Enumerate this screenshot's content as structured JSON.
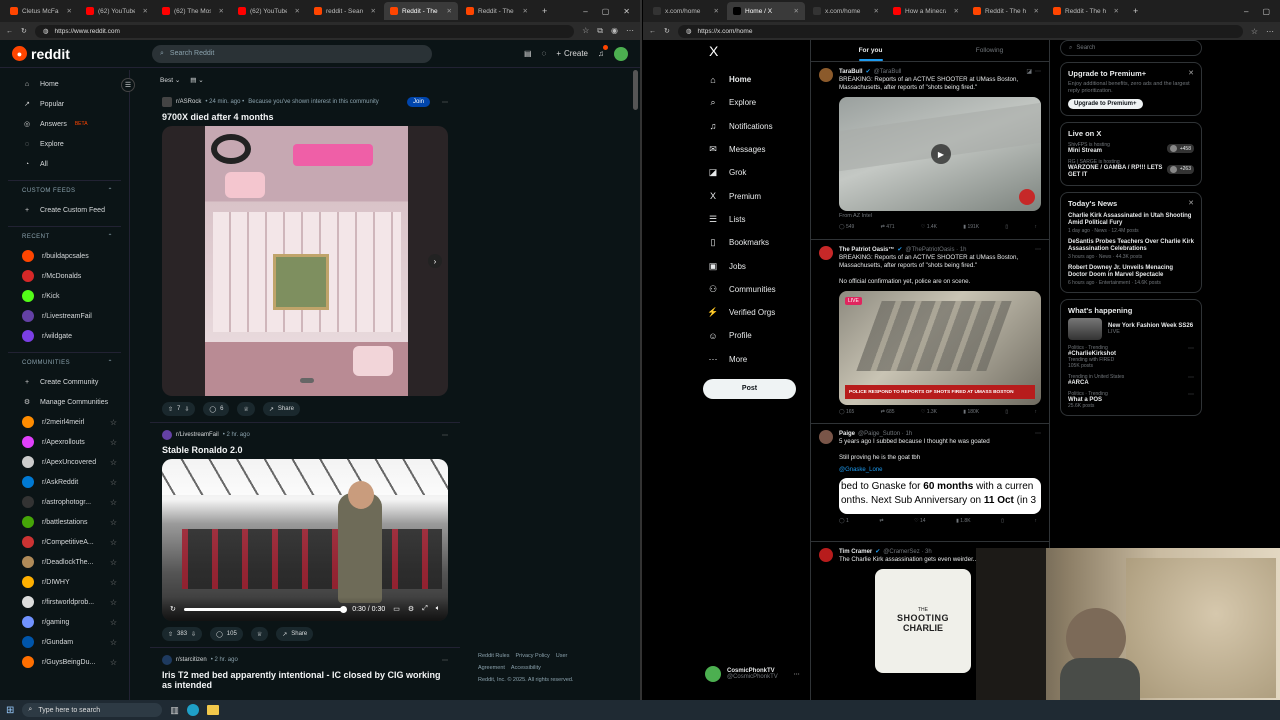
{
  "left_browser": {
    "tabs": [
      {
        "title": "Cletus McFarland",
        "color": "#ff4500"
      },
      {
        "title": "(62) YouTube",
        "color": "#ff0000"
      },
      {
        "title": "(62) The Most Secre",
        "color": "#ff0000"
      },
      {
        "title": "(62) YouTube",
        "color": "#ff0000"
      },
      {
        "title": "reddit - Search",
        "color": "#ff4500"
      },
      {
        "title": "Reddit - The heart o",
        "color": "#ff4500",
        "active": true
      },
      {
        "title": "Reddit - The heart o",
        "color": "#ff4500"
      }
    ],
    "url": "https://www.reddit.com"
  },
  "reddit": {
    "brand": "reddit",
    "search_placeholder": "Search Reddit",
    "create_label": "Create",
    "nav": [
      {
        "label": "Home",
        "icon": "home-icon",
        "glyph": "⌂"
      },
      {
        "label": "Popular",
        "icon": "popular-icon",
        "glyph": "↗"
      },
      {
        "label": "Answers",
        "icon": "answers-icon",
        "glyph": "◎",
        "badge": "BETA"
      },
      {
        "label": "Explore",
        "icon": "explore-icon",
        "glyph": "◌"
      },
      {
        "label": "All",
        "icon": "all-icon",
        "glyph": "◔"
      }
    ],
    "custom_feeds_title": "CUSTOM FEEDS",
    "create_custom_feed": "Create Custom Feed",
    "recent_title": "RECENT",
    "recent": [
      {
        "name": "r/buildapcsales",
        "color": "#ff4500"
      },
      {
        "name": "r/McDonalds",
        "color": "#d62828"
      },
      {
        "name": "r/Kick",
        "color": "#53fc18"
      },
      {
        "name": "r/LivestreamFail",
        "color": "#6441a5"
      },
      {
        "name": "r/wildgate",
        "color": "#7b3fe4"
      }
    ],
    "communities_title": "COMMUNITIES",
    "create_community": "Create Community",
    "manage_communities": "Manage Communities",
    "communities": [
      {
        "name": "r/2meirl4meirl",
        "color": "#ff8c00"
      },
      {
        "name": "r/Apexrollouts",
        "color": "#e040fb"
      },
      {
        "name": "r/ApexUncovered",
        "color": "#cccccc"
      },
      {
        "name": "r/AskReddit",
        "color": "#0079d3"
      },
      {
        "name": "r/astrophotogr...",
        "color": "#333333"
      },
      {
        "name": "r/battlestations",
        "color": "#46a508"
      },
      {
        "name": "r/CompetitiveA...",
        "color": "#cc3333"
      },
      {
        "name": "r/DeadlockThe...",
        "color": "#b08b59"
      },
      {
        "name": "r/DIWHY",
        "color": "#ffb000"
      },
      {
        "name": "r/firstworldprob...",
        "color": "#dddddd"
      },
      {
        "name": "r/gaming",
        "color": "#7193ff"
      },
      {
        "name": "r/Gundam",
        "color": "#0055aa"
      },
      {
        "name": "r/GuysBeingDu...",
        "color": "#ff6f00"
      }
    ],
    "sort_label": "Best",
    "posts": [
      {
        "sub": "r/ASRock",
        "time": "24 min. ago",
        "reason": "Because you've shown interest in this community",
        "join": "Join",
        "title": "9700X died after 4 months",
        "votes": "7",
        "comments": "6",
        "share": "Share"
      },
      {
        "sub": "r/LivestreamFail",
        "time": "2 hr. ago",
        "title": "Stable Ronaldo 2.0",
        "video_time": "0:30 / 0:30",
        "votes": "383",
        "comments": "105",
        "share": "Share"
      },
      {
        "sub": "r/starcitizen",
        "time": "2 hr. ago",
        "title": "Iris T2 med bed apparently intentional - IC closed by CIG working as intended"
      }
    ],
    "footer": {
      "links": [
        "Reddit Rules",
        "Privacy Policy",
        "User Agreement",
        "Accessibility"
      ],
      "copyright": "Reddit, Inc. © 2025. All rights reserved."
    }
  },
  "right_browser": {
    "tabs": [
      {
        "title": "x.com/home",
        "color": "#333333"
      },
      {
        "title": "Home / X",
        "color": "#000000",
        "active": true
      },
      {
        "title": "x.com/home",
        "color": "#333333"
      },
      {
        "title": "How a Minecraft Sc",
        "color": "#ff0000"
      },
      {
        "title": "Reddit - The heart",
        "color": "#ff4500"
      },
      {
        "title": "Reddit - The heart",
        "color": "#ff4500"
      }
    ],
    "url": "https://x.com/home"
  },
  "x": {
    "logo": "X",
    "nav": [
      {
        "label": "Home",
        "glyph": "⌂",
        "icon": "home-icon",
        "active": true
      },
      {
        "label": "Explore",
        "glyph": "⌕",
        "icon": "explore-icon"
      },
      {
        "label": "Notifications",
        "glyph": "♫",
        "icon": "bell-icon"
      },
      {
        "label": "Messages",
        "glyph": "✉",
        "icon": "mail-icon"
      },
      {
        "label": "Grok",
        "glyph": "◪",
        "icon": "grok-icon"
      },
      {
        "label": "Premium",
        "glyph": "X",
        "icon": "premium-icon"
      },
      {
        "label": "Lists",
        "glyph": "☰",
        "icon": "lists-icon"
      },
      {
        "label": "Bookmarks",
        "glyph": "▯",
        "icon": "bookmark-icon"
      },
      {
        "label": "Jobs",
        "glyph": "▣",
        "icon": "jobs-icon"
      },
      {
        "label": "Communities",
        "glyph": "⚇",
        "icon": "communities-icon"
      },
      {
        "label": "Verified Orgs",
        "glyph": "⚡",
        "icon": "verified-orgs-icon"
      },
      {
        "label": "Profile",
        "glyph": "☺",
        "icon": "profile-icon"
      },
      {
        "label": "More",
        "glyph": "⋯",
        "icon": "more-icon"
      }
    ],
    "post_button": "Post",
    "account": {
      "name": "CosmicPhonkTV",
      "handle": "@CosmicPhonkTV"
    },
    "feed_tabs": [
      "For you",
      "Following"
    ],
    "posted_pill": "posted",
    "tweets": [
      {
        "name": "TaraBull",
        "handle": "@TaraBull",
        "text": "BREAKING: Reports of an ACTIVE SHOOTER at UMass Boston, Massachusetts, after reports of \"shots being fired.\"",
        "source": "From AZ Intel",
        "stats": [
          "549",
          "471",
          "1.4K",
          "191K"
        ],
        "avatar": "#8b5a2b"
      },
      {
        "name": "The Patriot Oasis™",
        "handle": "@ThePatriotOasis · 1h",
        "text": "BREAKING: Reports of an ACTIVE SHOOTER at UMass Boston, Massachusetts, after reports of \"shots being fired.\"\n\nNo official confirmation yet, police are on scene.",
        "live": "LIVE",
        "chyron": "POLICE RESPOND TO REPORTS OF SHOTS FIRED AT UMASS BOSTON",
        "stats": [
          "165",
          "685",
          "1.3K",
          "180K"
        ],
        "avatar": "#c62828"
      },
      {
        "name": "Paige",
        "handle": "@Paige_Sutton · 1h",
        "text": "5 years ago I subbed because I thought he was goated\n\nStill proving he is the goat tbh",
        "mention": "@Gnaske_Lone",
        "banner_text_a": "bed to Gnaske for ",
        "banner_bold_a": "60 months",
        "banner_text_b": " with a curren",
        "banner_text_c": "onths. Next Sub Anniversary on ",
        "banner_bold_c": "11 Oct",
        "banner_text_d": " (in 3",
        "stats": [
          "1",
          "",
          "14",
          "1.8K"
        ],
        "avatar": "#795548"
      },
      {
        "name": "Tim Cramer",
        "handle": "@CramerSez · 3h",
        "text": "The Charlie Kirk assassination gets even weirder...",
        "book_top": "THE",
        "book_title": "SHOOTING",
        "book_sub": "CHARLIE",
        "avatar": "#b71c1c"
      }
    ],
    "search_placeholder": "Search",
    "premium": {
      "title": "Upgrade to Premium+",
      "body": "Enjoy additional benefits, zero ads and the largest reply prioritization.",
      "button": "Upgrade to Premium+"
    },
    "live": {
      "title": "Live on X",
      "items": [
        {
          "host": "ShivFPS",
          "status": "is hosting",
          "title": "Mini Stream",
          "count": "+458"
        },
        {
          "host": "RG | SARGE",
          "status": "is hosting",
          "title": "WARZONE / GAMBA / RP!!! LETS GET IT",
          "count": "+263"
        }
      ]
    },
    "news": {
      "title": "Today's News",
      "items": [
        {
          "title": "Charlie Kirk Assassinated in Utah Shooting Amid Political Fury",
          "meta": "1 day ago · News · 12.4M posts"
        },
        {
          "title": "DeSantis Probes Teachers Over Charlie Kirk Assassination Celebrations",
          "meta": "3 hours ago · News · 44.3K posts"
        },
        {
          "title": "Robert Downey Jr. Unveils Menacing Doctor Doom in Marvel Spectacle",
          "meta": "6 hours ago · Entertainment · 14.6K posts"
        }
      ]
    },
    "happening": {
      "title": "What's happening",
      "event": {
        "title": "New York Fashion Week SS26",
        "status": "LIVE"
      },
      "trends": [
        {
          "context": "Politics · Trending",
          "title": "#CharlieKirkshot",
          "meta": "Trending with FIRED",
          "posts": "105K posts"
        },
        {
          "context": "Trending in United States",
          "title": "#ARCA",
          "meta": "",
          "posts": ""
        },
        {
          "context": "Politics · Trending",
          "title": "What a POS",
          "meta": "",
          "posts": "25.6K posts"
        }
      ]
    }
  },
  "taskbar": {
    "search_placeholder": "Type here to search"
  }
}
